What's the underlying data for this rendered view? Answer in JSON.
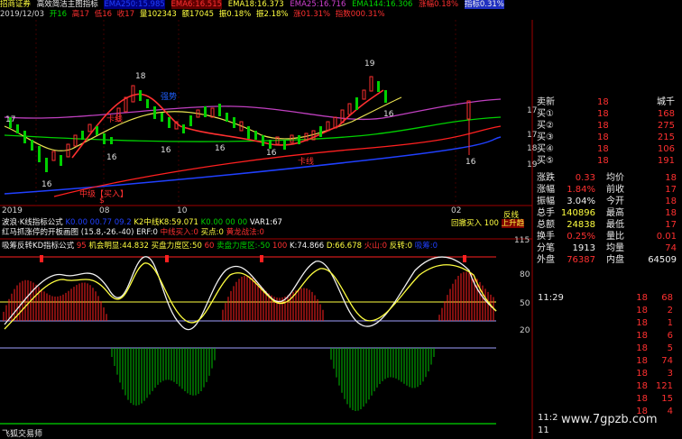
{
  "header": {
    "stock_name": "招商证券",
    "indicator_name": "高效简洁主图指标",
    "ema250": "EMA250:15.985",
    "ema6": "EMA6:16.515",
    "ema18": "EMA18:16.373",
    "ema25": "EMA25:16.716",
    "ema144": "EMA144:16.306",
    "line_a": "涨幅0.18%",
    "line_b": "指标0.31%"
  },
  "info_row": {
    "date": "2019/12/03",
    "open": "开16",
    "high": "高17",
    "low": "低16",
    "close": "收17",
    "volume": "量102343",
    "amount": "额17045",
    "change": "振0.18%",
    "amplitude": "振2.18%",
    "pct_a": "涨01.31%",
    "pct_b": "指数000.31%"
  },
  "main_chart": {
    "price_labels": [
      "17",
      "16",
      "16",
      "16",
      "16",
      "16",
      "18",
      "16",
      "16",
      "19"
    ],
    "annotations": {
      "blue_label": "强势",
      "red_label_1": "中级【买入】",
      "red_label_2": "$",
      "red_label_3": "卡线",
      "red_label_4": "卡线"
    },
    "axis_ticks": [
      "17",
      "17",
      "18",
      "19"
    ]
  },
  "date_axis": {
    "labels": [
      "2019",
      "08",
      "10",
      "02"
    ]
  },
  "sub_indicator_1": {
    "name": "波浪·K线指标公式",
    "vals": [
      "K0.00 00.77 09.2",
      "K2中线K8:59.071",
      "K0.00 00 00",
      "VAR1:67"
    ],
    "right_label_1": "回撤买入",
    "right_label_2": "100",
    "right_label_3": "上升趋"
  },
  "sub_indicator_2": {
    "name": "红马抓涨停的开板画图",
    "vals": [
      "(15.8,-26.-40)",
      "ERF:0",
      "中线买入:0",
      "买点:0",
      "黄龙战法:0"
    ]
  },
  "sub_indicator_3": {
    "name": "吸筹反转KD指标公式",
    "vals": [
      "95",
      "机会明显:44.832",
      "买盘力度区:50",
      "60",
      "卖盘力度区:-50",
      "100",
      "K:74.866",
      "D:66.678",
      "火山:0",
      "反转:0",
      "吸筹:0"
    ],
    "ticks": [
      "115",
      "80",
      "50",
      "20"
    ]
  },
  "right_panel": {
    "top_rows": [
      {
        "label": "卖新",
        "p": "18",
        "q": "城千"
      },
      {
        "label": "买①",
        "p": "18",
        "q": "168"
      },
      {
        "label": "买②",
        "p": "18",
        "q": "275"
      },
      {
        "label": "买③",
        "p": "18",
        "q": "215"
      },
      {
        "label": "买④",
        "p": "18",
        "q": "106"
      },
      {
        "label": "买⑤",
        "p": "18",
        "q": "191"
      }
    ],
    "stats": [
      {
        "l1": "涨跌",
        "v1": "0.33",
        "l2": "均价",
        "v2": "18"
      },
      {
        "l1": "涨幅",
        "v1": "1.84%",
        "l2": "前收",
        "v2": "17"
      },
      {
        "l1": "振幅",
        "v1": "3.04%",
        "l2": "今开",
        "v2": "18"
      },
      {
        "l1": "总手",
        "v1": "140896",
        "l2": "最高",
        "v2": "18"
      },
      {
        "l1": "总额",
        "v1": "24838",
        "l2": "最低",
        "v2": "17"
      },
      {
        "l1": "换手",
        "v1": "0.25%",
        "l2": "量比",
        "v2": "0.01"
      },
      {
        "l1": "分笔",
        "v1": "1913",
        "l2": "均量",
        "v2": "74"
      },
      {
        "l1": "外盘",
        "v1": "76387",
        "l2": "内盘",
        "v2": "64509"
      }
    ],
    "ticks": [
      {
        "t": "11:29",
        "p": "18",
        "q": "68"
      },
      {
        "t": "",
        "p": "18",
        "q": "2"
      },
      {
        "t": "",
        "p": "18",
        "q": "1"
      },
      {
        "t": "",
        "p": "18",
        "q": "6"
      },
      {
        "t": "",
        "p": "18",
        "q": "5"
      },
      {
        "t": "",
        "p": "18",
        "q": "74"
      },
      {
        "t": "",
        "p": "18",
        "q": "3"
      },
      {
        "t": "",
        "p": "18",
        "q": "121"
      },
      {
        "t": "",
        "p": "18",
        "q": "15"
      },
      {
        "t": "",
        "p": "18",
        "q": "4"
      }
    ],
    "clock_top": "11:2",
    "clock_bottom": "11"
  },
  "footer": {
    "app": "飞狐交易师",
    "watermark": "www.7gpzb.com"
  },
  "colors": {
    "red": "#ff3030",
    "green": "#00d800",
    "yellow": "#ffff40",
    "blue": "#2040ff",
    "magenta": "#d040d0"
  }
}
